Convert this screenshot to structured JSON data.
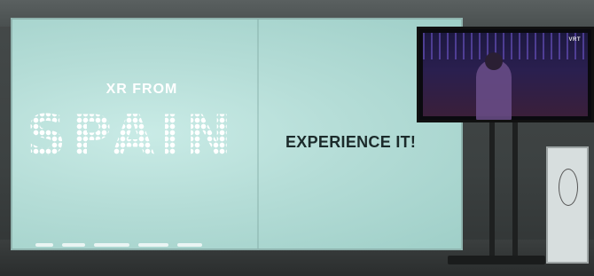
{
  "banner": {
    "headline_small": "XR FROM",
    "headline_large": "SPAIN",
    "tagline": "EXPERIENCE IT!"
  },
  "tv": {
    "corner_label": "VRT"
  },
  "colors": {
    "banner_glow": "#b5ddd7",
    "tagline_text": "#1c2b2b",
    "headline_text": "#ffffff"
  }
}
